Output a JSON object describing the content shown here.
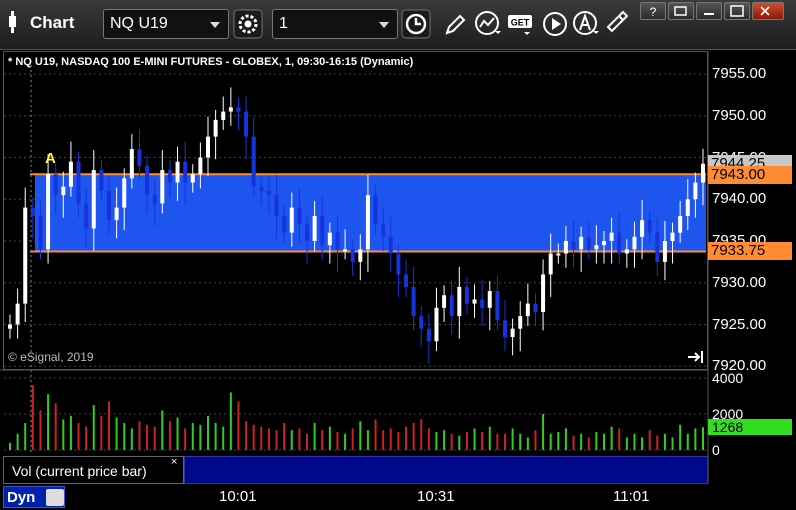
{
  "window": {
    "title": "Chart",
    "symbol": "NQ U19",
    "interval": "1",
    "get_label": "GET"
  },
  "chart": {
    "header": "* NQ U19, NASDAQ 100 E-MINI FUTURES - GLOBEX, 1, 09:30-16:15 (Dynamic)",
    "copyright": "© eSignal, 2019",
    "marker": "A",
    "price_ticks": [
      "7955.00",
      "7950.00",
      "7945.00",
      "7940.00",
      "7935.00",
      "7930.00",
      "7925.00",
      "7920.00"
    ],
    "volume_ticks": [
      "4000",
      "2000",
      "0"
    ],
    "time_ticks": [
      "10:01",
      "10:31",
      "11:01"
    ],
    "last_price": "7944.25",
    "band_high_label": "7943.00",
    "band_low_label": "7933.75",
    "volume_last": "1268",
    "study_label": "Vol (current price bar)",
    "study_close": "×",
    "status_mode": "Dyn"
  },
  "colors": {
    "band": "#1e55ee",
    "band_line": "#ff8c33",
    "up_candle": "#ffffff",
    "down_candle": "#1733dd",
    "vol_up": "#33cc22",
    "vol_down": "#cc2222",
    "last_price_bg": "#c8c8c8"
  },
  "chart_data": {
    "type": "candlestick",
    "symbol": "NQ U19",
    "interval_minutes": 1,
    "y_range": [
      7920,
      7957
    ],
    "volume_range": [
      0,
      4000
    ],
    "band": {
      "high": 7943.0,
      "low": 7933.75
    },
    "last_price": 7944.25,
    "last_volume": 1268,
    "close_series": [
      7925.0,
      7927.5,
      7939.0,
      7938.0,
      7934.0,
      7943.0,
      7940.5,
      7941.5,
      7944.5,
      7939.5,
      7936.5,
      7943.5,
      7941.0,
      7937.5,
      7939.0,
      7942.5,
      7946.0,
      7944.0,
      7940.5,
      7939.5,
      7943.5,
      7942.0,
      7944.5,
      7942.0,
      7943.0,
      7945.0,
      7947.5,
      7949.5,
      7950.5,
      7951.0,
      7950.5,
      7947.5,
      7941.5,
      7941.0,
      7940.5,
      7938.0,
      7936.0,
      7939.0,
      7937.0,
      7935.0,
      7938.0,
      7934.5,
      7936.0,
      7934.0,
      7934.0,
      7932.5,
      7934.0,
      7940.5,
      7937.0,
      7935.5,
      7933.5,
      7931.0,
      7929.5,
      7926.0,
      7924.5,
      7923.0,
      7927.0,
      7928.5,
      7926.0,
      7929.5,
      7927.5,
      7928.0,
      7927.0,
      7929.0,
      7925.5,
      7923.5,
      7924.5,
      7926.0,
      7927.5,
      7926.5,
      7931.0,
      7933.5,
      7933.5,
      7935.0,
      7934.0,
      7935.5,
      7934.0,
      7934.5,
      7935.0,
      7936.0,
      7933.5,
      7934.0,
      7935.5,
      7937.5,
      7936.0,
      7932.5,
      7935.0,
      7936.0,
      7938.0,
      7940.0,
      7942.0,
      7944.25
    ],
    "volume_series": [
      400,
      900,
      1500,
      3600,
      2200,
      3100,
      2600,
      1700,
      1900,
      1500,
      1300,
      2500,
      1900,
      2700,
      1800,
      1500,
      1200,
      1600,
      1400,
      1300,
      2200,
      1600,
      1800,
      1200,
      1500,
      1400,
      1900,
      1500,
      1300,
      3200,
      2700,
      1600,
      1400,
      1300,
      1200,
      1100,
      1500,
      1100,
      1200,
      900,
      1500,
      1100,
      1300,
      1000,
      900,
      1200,
      1600,
      1100,
      1700,
      1100,
      1200,
      1000,
      1300,
      1500,
      1700,
      1200,
      1000,
      1100,
      900,
      800,
      1000,
      1200,
      1000,
      1300,
      900,
      900,
      1200,
      900,
      700,
      1100,
      2000,
      900,
      1000,
      1200,
      800,
      900,
      700,
      1000,
      900,
      1300,
      1200,
      700,
      900,
      700,
      1100,
      800,
      900,
      700,
      1400,
      900,
      1200,
      1268
    ],
    "time_ticks": [
      "10:01",
      "10:31",
      "11:01"
    ]
  }
}
